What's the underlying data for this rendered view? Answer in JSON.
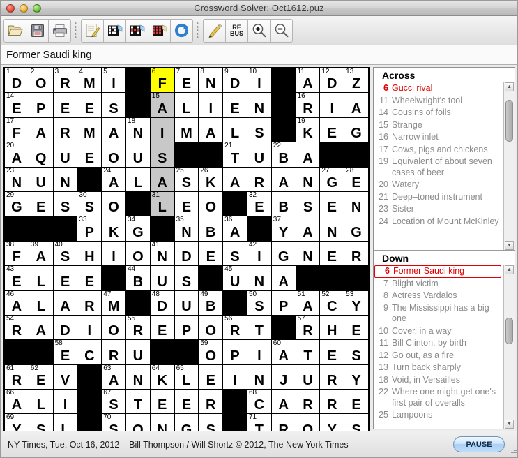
{
  "window": {
    "title": "Crossword Solver: Oct1612.puz",
    "controls": [
      "close-button",
      "minimize-button",
      "zoom-button"
    ]
  },
  "toolbar": {
    "groups": [
      [
        {
          "name": "open-file-button",
          "icon": "folder-open-icon",
          "label": ""
        },
        {
          "name": "save-file-button",
          "icon": "floppy-disk-icon",
          "label": ""
        },
        {
          "name": "print-button",
          "icon": "printer-icon",
          "label": ""
        }
      ],
      [
        {
          "name": "notes-button",
          "icon": "notepad-pencil-icon",
          "label": ""
        },
        {
          "name": "check-letter-button",
          "icon": "grid-check-icon",
          "label": ""
        },
        {
          "name": "check-word-button",
          "icon": "grid-word-icon",
          "label": ""
        },
        {
          "name": "reveal-button",
          "icon": "grid-reveal-icon",
          "label": ""
        },
        {
          "name": "refresh-button",
          "icon": "circular-arrow-icon",
          "label": ""
        }
      ],
      [
        {
          "name": "pencil-mode-button",
          "icon": "pencil-icon",
          "label": ""
        },
        {
          "name": "rebus-button",
          "icon": "rebus-icon",
          "label": "RE\nBUS",
          "line1": "RE",
          "line2": "BUS"
        },
        {
          "name": "zoom-in-button",
          "icon": "magnifier-plus-icon",
          "label": ""
        },
        {
          "name": "zoom-out-button",
          "icon": "magnifier-minus-icon",
          "label": ""
        }
      ]
    ]
  },
  "clue_bar": {
    "current_clue": "Former Saudi king"
  },
  "grid": {
    "rows": 15,
    "cols": 15,
    "colors": {
      "current_cell": "#ffff00",
      "current_word": "#c8c8c8",
      "block": "#000000",
      "empty": "#ffffff"
    },
    "cells": [
      [
        {
          "n": "1",
          "l": "D"
        },
        {
          "n": "2",
          "l": "O"
        },
        {
          "n": "3",
          "l": "R"
        },
        {
          "n": "4",
          "l": "M"
        },
        {
          "n": "5",
          "l": "I"
        },
        {
          "b": true
        },
        {
          "n": "6",
          "l": "F",
          "s": "cur"
        },
        {
          "n": "7",
          "l": "E"
        },
        {
          "n": "8",
          "l": "N"
        },
        {
          "n": "9",
          "l": "D"
        },
        {
          "n": "10",
          "l": "I"
        },
        {
          "b": true
        },
        {
          "n": "11",
          "l": "A"
        },
        {
          "n": "12",
          "l": "D"
        },
        {
          "n": "13",
          "l": "Z"
        }
      ],
      [
        {
          "n": "14",
          "l": "E"
        },
        {
          "l": "P"
        },
        {
          "l": "E"
        },
        {
          "l": "E"
        },
        {
          "l": "S"
        },
        {
          "b": true
        },
        {
          "n": "15",
          "l": "A",
          "s": "hl"
        },
        {
          "l": "L"
        },
        {
          "l": "I"
        },
        {
          "l": "E"
        },
        {
          "l": "N"
        },
        {
          "b": true
        },
        {
          "n": "16",
          "l": "R"
        },
        {
          "l": "I"
        },
        {
          "l": "A"
        }
      ],
      [
        {
          "n": "17",
          "l": "F"
        },
        {
          "l": "A"
        },
        {
          "l": "R"
        },
        {
          "l": "M"
        },
        {
          "l": "A"
        },
        {
          "n": "18",
          "l": "N"
        },
        {
          "l": "I",
          "s": "hl"
        },
        {
          "l": "M"
        },
        {
          "l": "A"
        },
        {
          "l": "L"
        },
        {
          "l": "S"
        },
        {
          "b": true
        },
        {
          "n": "19",
          "l": "K"
        },
        {
          "l": "E"
        },
        {
          "l": "G"
        }
      ],
      [
        {
          "n": "20",
          "l": "A"
        },
        {
          "l": "Q"
        },
        {
          "l": "U"
        },
        {
          "l": "E"
        },
        {
          "l": "O"
        },
        {
          "l": "U"
        },
        {
          "l": "S",
          "s": "hl"
        },
        {
          "b": true
        },
        {
          "b": true
        },
        {
          "n": "21",
          "l": "T"
        },
        {
          "l": "U"
        },
        {
          "n": "22",
          "l": "B"
        },
        {
          "l": "A"
        },
        {
          "b": true
        },
        {
          "b": true
        }
      ],
      [
        {
          "n": "23",
          "l": "N"
        },
        {
          "l": "U"
        },
        {
          "l": "N"
        },
        {
          "b": true
        },
        {
          "n": "24",
          "l": "A"
        },
        {
          "l": "L"
        },
        {
          "l": "A",
          "s": "hl"
        },
        {
          "n": "25",
          "l": "S"
        },
        {
          "n": "26",
          "l": "K"
        },
        {
          "l": "A"
        },
        {
          "l": "R"
        },
        {
          "l": "A"
        },
        {
          "l": "N"
        },
        {
          "n": "27",
          "l": "G"
        },
        {
          "n": "28",
          "l": "E"
        }
      ],
      [
        {
          "n": "29",
          "l": "G"
        },
        {
          "l": "E"
        },
        {
          "l": "S"
        },
        {
          "n": "30",
          "l": "S"
        },
        {
          "l": "O"
        },
        {
          "b": true
        },
        {
          "n": "31",
          "l": "L",
          "s": "hl"
        },
        {
          "l": "E"
        },
        {
          "l": "O"
        },
        {
          "b": true
        },
        {
          "n": "32",
          "l": "E"
        },
        {
          "l": "B"
        },
        {
          "l": "S"
        },
        {
          "l": "E"
        },
        {
          "l": "N"
        }
      ],
      [
        {
          "b": true
        },
        {
          "b": true
        },
        {
          "b": true
        },
        {
          "n": "33",
          "l": "P"
        },
        {
          "l": "K"
        },
        {
          "n": "34",
          "l": "G"
        },
        {
          "b": true
        },
        {
          "n": "35",
          "l": "N"
        },
        {
          "l": "B"
        },
        {
          "n": "36",
          "l": "A"
        },
        {
          "b": true
        },
        {
          "n": "37",
          "l": "Y"
        },
        {
          "l": "A"
        },
        {
          "l": "N"
        },
        {
          "l": "G"
        }
      ],
      [
        {
          "n": "38",
          "l": "F"
        },
        {
          "n": "39",
          "l": "A"
        },
        {
          "n": "40",
          "l": "S"
        },
        {
          "l": "H"
        },
        {
          "l": "I"
        },
        {
          "l": "O"
        },
        {
          "n": "41",
          "l": "N"
        },
        {
          "l": "D"
        },
        {
          "l": "E"
        },
        {
          "l": "S"
        },
        {
          "n": "42",
          "l": "I"
        },
        {
          "l": "G"
        },
        {
          "l": "N"
        },
        {
          "l": "E"
        },
        {
          "l": "R"
        }
      ],
      [
        {
          "n": "43",
          "l": "E"
        },
        {
          "l": "L"
        },
        {
          "l": "E"
        },
        {
          "l": "E"
        },
        {
          "b": true
        },
        {
          "n": "44",
          "l": "B"
        },
        {
          "l": "U"
        },
        {
          "l": "S"
        },
        {
          "b": true
        },
        {
          "n": "45",
          "l": "U"
        },
        {
          "l": "N"
        },
        {
          "l": "A"
        },
        {
          "b": true
        },
        {
          "b": true
        },
        {
          "b": true
        }
      ],
      [
        {
          "n": "46",
          "l": "A"
        },
        {
          "l": "L"
        },
        {
          "l": "A"
        },
        {
          "l": "R"
        },
        {
          "n": "47",
          "l": "M"
        },
        {
          "b": true
        },
        {
          "n": "48",
          "l": "D"
        },
        {
          "l": "U"
        },
        {
          "n": "49",
          "l": "B"
        },
        {
          "b": true
        },
        {
          "n": "50",
          "l": "S"
        },
        {
          "l": "P"
        },
        {
          "n": "51",
          "l": "A"
        },
        {
          "n": "52",
          "l": "C"
        },
        {
          "n": "53",
          "l": "Y"
        }
      ],
      [
        {
          "n": "54",
          "l": "R"
        },
        {
          "l": "A"
        },
        {
          "l": "D"
        },
        {
          "l": "I"
        },
        {
          "l": "O"
        },
        {
          "n": "55",
          "l": "R"
        },
        {
          "l": "E"
        },
        {
          "l": "P"
        },
        {
          "l": "O"
        },
        {
          "n": "56",
          "l": "R"
        },
        {
          "l": "T"
        },
        {
          "b": true
        },
        {
          "n": "57",
          "l": "R"
        },
        {
          "l": "H"
        },
        {
          "l": "E"
        }
      ],
      [
        {
          "b": true
        },
        {
          "b": true
        },
        {
          "n": "58",
          "l": "E"
        },
        {
          "l": "C"
        },
        {
          "l": "R"
        },
        {
          "l": "U"
        },
        {
          "b": true
        },
        {
          "b": true
        },
        {
          "n": "59",
          "l": "O"
        },
        {
          "l": "P"
        },
        {
          "l": "I"
        },
        {
          "n": "60",
          "l": "A"
        },
        {
          "l": "T"
        },
        {
          "l": "E"
        },
        {
          "l": "S"
        }
      ],
      [
        {
          "n": "61",
          "l": "R"
        },
        {
          "n": "62",
          "l": "E"
        },
        {
          "l": "V"
        },
        {
          "b": true
        },
        {
          "n": "63",
          "l": "A"
        },
        {
          "l": "N"
        },
        {
          "n": "64",
          "l": "K"
        },
        {
          "n": "65",
          "l": "L"
        },
        {
          "l": "E"
        },
        {
          "l": "I"
        },
        {
          "l": "N"
        },
        {
          "l": "J"
        },
        {
          "l": "U"
        },
        {
          "l": "R"
        },
        {
          "l": "Y"
        }
      ],
      [
        {
          "n": "66",
          "l": "A"
        },
        {
          "l": "L"
        },
        {
          "l": "I"
        },
        {
          "b": true
        },
        {
          "n": "67",
          "l": "S"
        },
        {
          "l": "T"
        },
        {
          "l": "E"
        },
        {
          "l": "E"
        },
        {
          "l": "R"
        },
        {
          "b": true
        },
        {
          "n": "68",
          "l": "C"
        },
        {
          "l": "A"
        },
        {
          "l": "R"
        },
        {
          "l": "R"
        },
        {
          "l": "E"
        }
      ],
      [
        {
          "n": "69",
          "l": "Y"
        },
        {
          "l": "S"
        },
        {
          "l": "L"
        },
        {
          "b": true
        },
        {
          "n": "70",
          "l": "S"
        },
        {
          "l": "O"
        },
        {
          "l": "N"
        },
        {
          "l": "G"
        },
        {
          "l": "S"
        },
        {
          "b": true
        },
        {
          "n": "71",
          "l": "T"
        },
        {
          "l": "R"
        },
        {
          "l": "O"
        },
        {
          "l": "Y"
        },
        {
          "l": "S"
        }
      ]
    ]
  },
  "clue_panel": {
    "across": {
      "heading": "Across",
      "selected_number": "6",
      "items": [
        {
          "n": "6",
          "t": "Gucci rival",
          "selected": true
        },
        {
          "n": "11",
          "t": "Wheelwright's tool"
        },
        {
          "n": "14",
          "t": "Cousins of foils"
        },
        {
          "n": "15",
          "t": "Strange"
        },
        {
          "n": "16",
          "t": "Narrow inlet"
        },
        {
          "n": "17",
          "t": "Cows, pigs and chickens"
        },
        {
          "n": "19",
          "t": "Equivalent of about seven cases of beer"
        },
        {
          "n": "20",
          "t": "Watery"
        },
        {
          "n": "21",
          "t": "Deep–toned instrument"
        },
        {
          "n": "23",
          "t": "Sister"
        },
        {
          "n": "24",
          "t": "Location of Mount McKinley"
        }
      ]
    },
    "down": {
      "heading": "Down",
      "selected_number": "6",
      "items": [
        {
          "n": "6",
          "t": "Former Saudi king",
          "selected": true,
          "boxed": true
        },
        {
          "n": "7",
          "t": "Blight victim"
        },
        {
          "n": "8",
          "t": "Actress Vardalos"
        },
        {
          "n": "9",
          "t": "The Mississippi has a big one"
        },
        {
          "n": "10",
          "t": "Cover, in a way"
        },
        {
          "n": "11",
          "t": "Bill Clinton, by birth"
        },
        {
          "n": "12",
          "t": "Go out, as a fire"
        },
        {
          "n": "13",
          "t": "Turn back sharply"
        },
        {
          "n": "18",
          "t": "Void, in Versailles"
        },
        {
          "n": "22",
          "t": "Where one might get one's first pair of overalls"
        },
        {
          "n": "25",
          "t": "Lampoons"
        }
      ]
    },
    "scrollbar": {
      "up_glyph": "▲",
      "down_glyph": "▼"
    }
  },
  "status": {
    "text": "NY Times, Tue, Oct 16, 2012 – Bill Thompson / Will Shortz  © 2012, The New York Times",
    "pause_label": "PAUSE"
  }
}
